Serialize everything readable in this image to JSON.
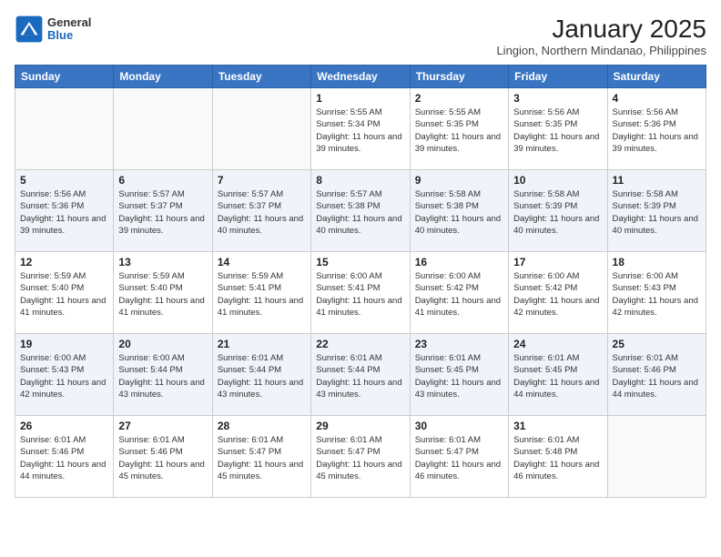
{
  "logo": {
    "general": "General",
    "blue": "Blue"
  },
  "title": "January 2025",
  "subtitle": "Lingion, Northern Mindanao, Philippines",
  "days_of_week": [
    "Sunday",
    "Monday",
    "Tuesday",
    "Wednesday",
    "Thursday",
    "Friday",
    "Saturday"
  ],
  "weeks": [
    [
      {
        "day": "",
        "info": ""
      },
      {
        "day": "",
        "info": ""
      },
      {
        "day": "",
        "info": ""
      },
      {
        "day": "1",
        "info": "Sunrise: 5:55 AM\nSunset: 5:34 PM\nDaylight: 11 hours and 39 minutes."
      },
      {
        "day": "2",
        "info": "Sunrise: 5:55 AM\nSunset: 5:35 PM\nDaylight: 11 hours and 39 minutes."
      },
      {
        "day": "3",
        "info": "Sunrise: 5:56 AM\nSunset: 5:35 PM\nDaylight: 11 hours and 39 minutes."
      },
      {
        "day": "4",
        "info": "Sunrise: 5:56 AM\nSunset: 5:36 PM\nDaylight: 11 hours and 39 minutes."
      }
    ],
    [
      {
        "day": "5",
        "info": "Sunrise: 5:56 AM\nSunset: 5:36 PM\nDaylight: 11 hours and 39 minutes."
      },
      {
        "day": "6",
        "info": "Sunrise: 5:57 AM\nSunset: 5:37 PM\nDaylight: 11 hours and 39 minutes."
      },
      {
        "day": "7",
        "info": "Sunrise: 5:57 AM\nSunset: 5:37 PM\nDaylight: 11 hours and 40 minutes."
      },
      {
        "day": "8",
        "info": "Sunrise: 5:57 AM\nSunset: 5:38 PM\nDaylight: 11 hours and 40 minutes."
      },
      {
        "day": "9",
        "info": "Sunrise: 5:58 AM\nSunset: 5:38 PM\nDaylight: 11 hours and 40 minutes."
      },
      {
        "day": "10",
        "info": "Sunrise: 5:58 AM\nSunset: 5:39 PM\nDaylight: 11 hours and 40 minutes."
      },
      {
        "day": "11",
        "info": "Sunrise: 5:58 AM\nSunset: 5:39 PM\nDaylight: 11 hours and 40 minutes."
      }
    ],
    [
      {
        "day": "12",
        "info": "Sunrise: 5:59 AM\nSunset: 5:40 PM\nDaylight: 11 hours and 41 minutes."
      },
      {
        "day": "13",
        "info": "Sunrise: 5:59 AM\nSunset: 5:40 PM\nDaylight: 11 hours and 41 minutes."
      },
      {
        "day": "14",
        "info": "Sunrise: 5:59 AM\nSunset: 5:41 PM\nDaylight: 11 hours and 41 minutes."
      },
      {
        "day": "15",
        "info": "Sunrise: 6:00 AM\nSunset: 5:41 PM\nDaylight: 11 hours and 41 minutes."
      },
      {
        "day": "16",
        "info": "Sunrise: 6:00 AM\nSunset: 5:42 PM\nDaylight: 11 hours and 41 minutes."
      },
      {
        "day": "17",
        "info": "Sunrise: 6:00 AM\nSunset: 5:42 PM\nDaylight: 11 hours and 42 minutes."
      },
      {
        "day": "18",
        "info": "Sunrise: 6:00 AM\nSunset: 5:43 PM\nDaylight: 11 hours and 42 minutes."
      }
    ],
    [
      {
        "day": "19",
        "info": "Sunrise: 6:00 AM\nSunset: 5:43 PM\nDaylight: 11 hours and 42 minutes."
      },
      {
        "day": "20",
        "info": "Sunrise: 6:00 AM\nSunset: 5:44 PM\nDaylight: 11 hours and 43 minutes."
      },
      {
        "day": "21",
        "info": "Sunrise: 6:01 AM\nSunset: 5:44 PM\nDaylight: 11 hours and 43 minutes."
      },
      {
        "day": "22",
        "info": "Sunrise: 6:01 AM\nSunset: 5:44 PM\nDaylight: 11 hours and 43 minutes."
      },
      {
        "day": "23",
        "info": "Sunrise: 6:01 AM\nSunset: 5:45 PM\nDaylight: 11 hours and 43 minutes."
      },
      {
        "day": "24",
        "info": "Sunrise: 6:01 AM\nSunset: 5:45 PM\nDaylight: 11 hours and 44 minutes."
      },
      {
        "day": "25",
        "info": "Sunrise: 6:01 AM\nSunset: 5:46 PM\nDaylight: 11 hours and 44 minutes."
      }
    ],
    [
      {
        "day": "26",
        "info": "Sunrise: 6:01 AM\nSunset: 5:46 PM\nDaylight: 11 hours and 44 minutes."
      },
      {
        "day": "27",
        "info": "Sunrise: 6:01 AM\nSunset: 5:46 PM\nDaylight: 11 hours and 45 minutes."
      },
      {
        "day": "28",
        "info": "Sunrise: 6:01 AM\nSunset: 5:47 PM\nDaylight: 11 hours and 45 minutes."
      },
      {
        "day": "29",
        "info": "Sunrise: 6:01 AM\nSunset: 5:47 PM\nDaylight: 11 hours and 45 minutes."
      },
      {
        "day": "30",
        "info": "Sunrise: 6:01 AM\nSunset: 5:47 PM\nDaylight: 11 hours and 46 minutes."
      },
      {
        "day": "31",
        "info": "Sunrise: 6:01 AM\nSunset: 5:48 PM\nDaylight: 11 hours and 46 minutes."
      },
      {
        "day": "",
        "info": ""
      }
    ]
  ]
}
